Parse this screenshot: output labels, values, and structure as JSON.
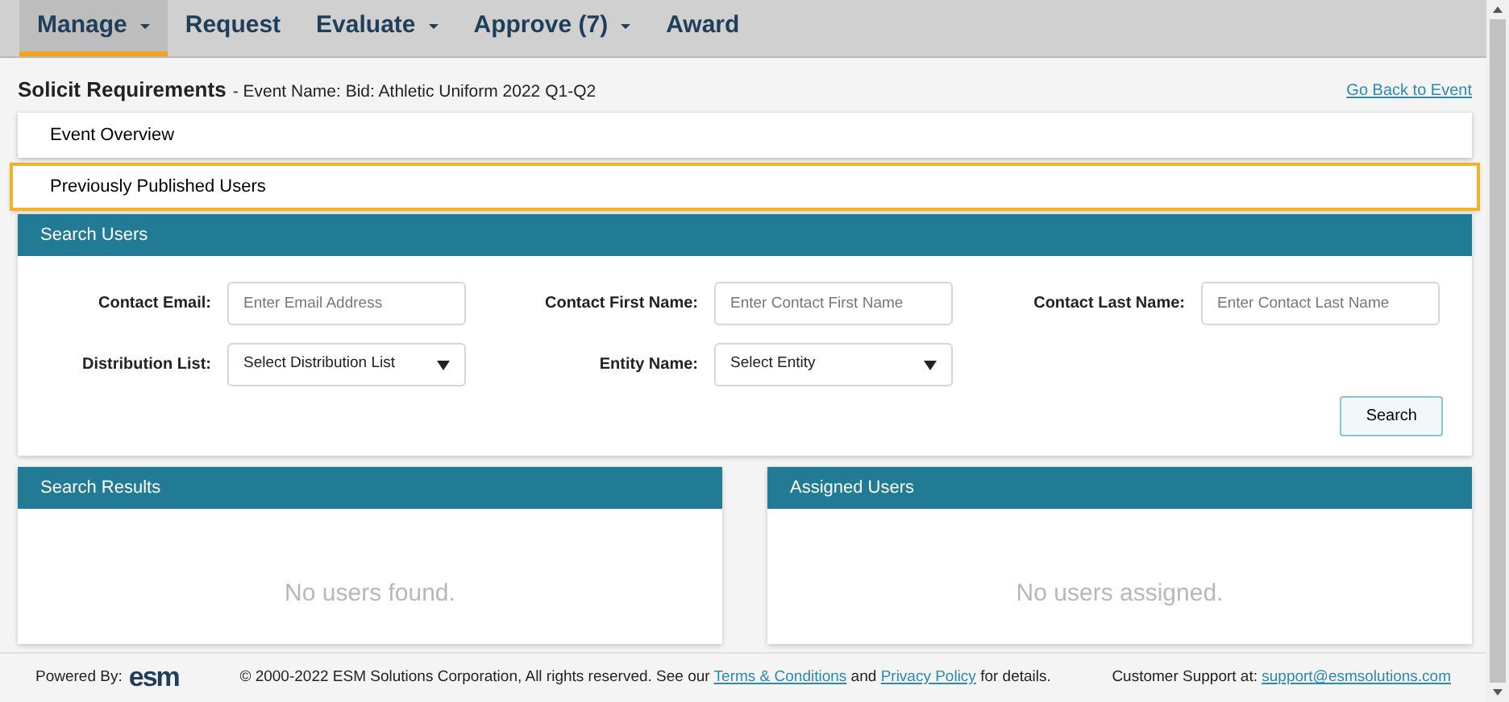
{
  "nav": {
    "tabs": [
      {
        "label": "Manage",
        "dropdown": true,
        "selected": true
      },
      {
        "label": "Request",
        "dropdown": false,
        "selected": false
      },
      {
        "label": "Evaluate",
        "dropdown": true,
        "selected": false
      },
      {
        "label": "Approve (7)",
        "dropdown": true,
        "selected": false
      },
      {
        "label": "Award",
        "dropdown": false,
        "selected": false
      }
    ]
  },
  "header": {
    "title": "Solicit Requirements",
    "subtitle": "- Event Name: Bid: Athletic Uniform 2022 Q1-Q2",
    "back_link": "Go Back to Event"
  },
  "sections": [
    {
      "label": "Event Overview",
      "selected": false
    },
    {
      "label": "Previously Published Users",
      "selected": true
    }
  ],
  "search_panel": {
    "title": "Search Users",
    "fields": [
      {
        "kind": "text",
        "label": "Contact Email:",
        "placeholder": "Enter Email Address"
      },
      {
        "kind": "text",
        "label": "Contact First Name:",
        "placeholder": "Enter Contact First Name"
      },
      {
        "kind": "text",
        "label": "Contact Last Name:",
        "placeholder": "Enter Contact Last Name"
      },
      {
        "kind": "select",
        "label": "Distribution List:",
        "value": "Select Distribution List"
      },
      {
        "kind": "select",
        "label": "Entity Name:",
        "value": "Select Entity"
      }
    ],
    "button": "Search"
  },
  "result_panels": [
    {
      "title": "Search Results",
      "empty_text": "No users found."
    },
    {
      "title": "Assigned Users",
      "empty_text": "No users assigned."
    }
  ],
  "footer": {
    "powered_by": "Powered By:",
    "logo": "esm",
    "copyright_before": "© 2000-2022 ESM Solutions Corporation, All rights reserved. See our",
    "terms_link": "Terms & Conditions",
    "middle": "and",
    "privacy_link": "Privacy Policy",
    "copyright_after": "for details.",
    "support_label": "Customer Support at:",
    "support_link": "support@esmsolutions.com"
  }
}
